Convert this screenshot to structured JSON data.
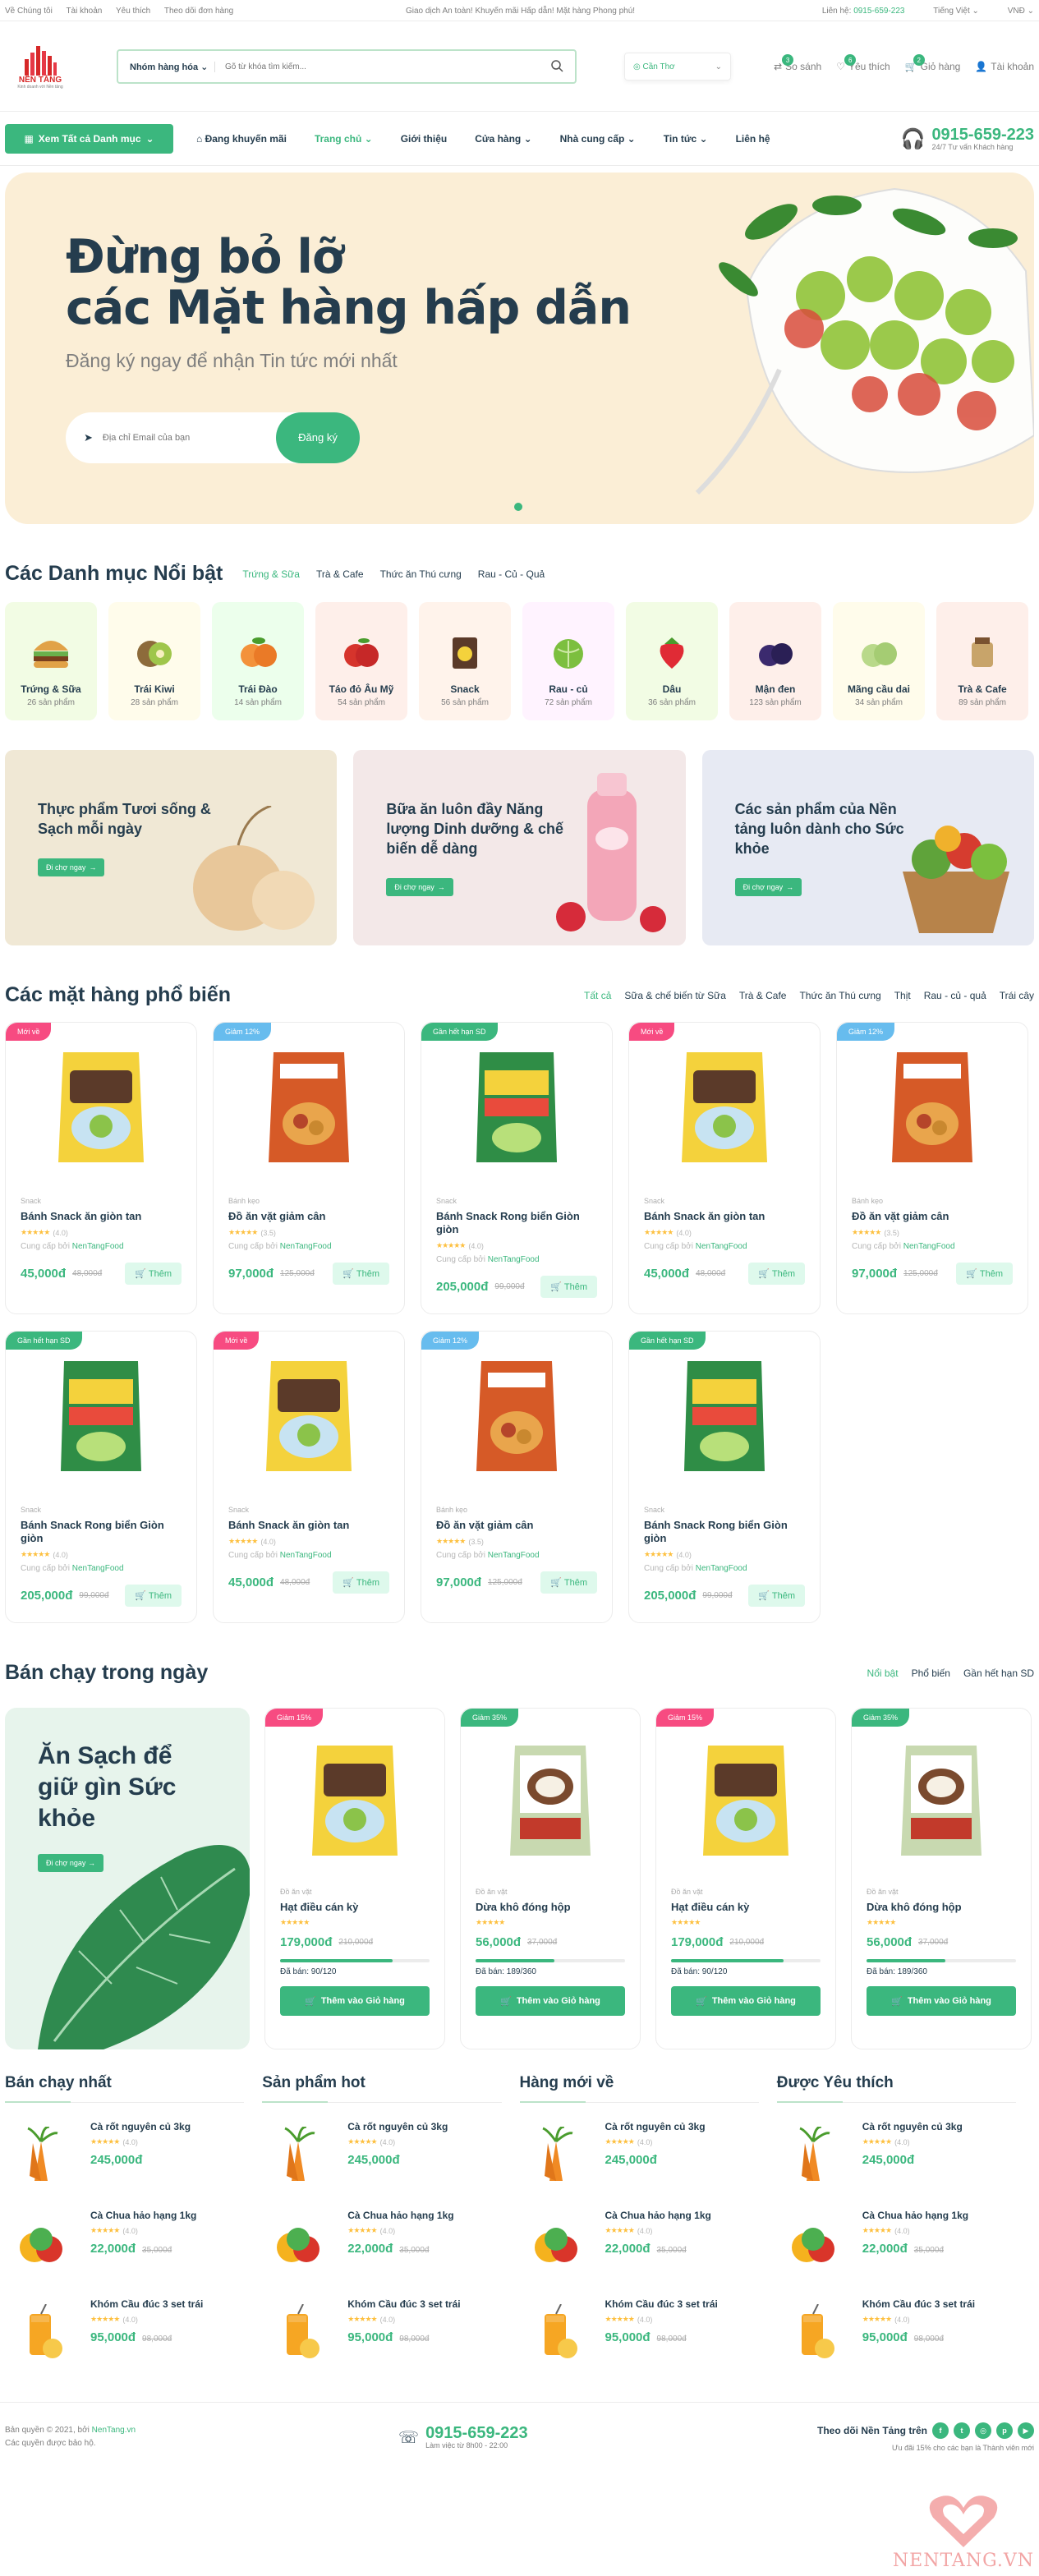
{
  "topbar": {
    "left": [
      "Về Chúng tôi",
      "Tài khoản",
      "Yêu thích",
      "Theo dõi đơn hàng"
    ],
    "center": "Giao dịch An toàn! Khuyến mãi Hấp dẫn! Mặt hàng Phong phú!",
    "hotline_label": "Liên hệ:",
    "hotline": "0915-659-223",
    "lang": "Tiếng Việt",
    "currency": "VNĐ"
  },
  "header": {
    "logo_name": "NỀN TẢNG",
    "logo_tag": "Kinh doanh với Nền tảng",
    "search_category": "Nhóm hàng hóa",
    "search_placeholder": "Gõ từ khóa tìm kiếm...",
    "location": "Cần Thơ",
    "compare": {
      "label": "So sánh",
      "count": "3"
    },
    "wishlist": {
      "label": "Yêu thích",
      "count": "6"
    },
    "cart": {
      "label": "Giỏ hàng",
      "count": "2"
    },
    "account": "Tài khoản"
  },
  "nav": {
    "browse": "Xem Tất cả Danh mục",
    "promo": "Đang khuyến mãi",
    "items": [
      "Trang chủ",
      "Giới thiệu",
      "Cửa hàng",
      "Nhà cung cấp",
      "Tin tức",
      "Liên hệ"
    ],
    "hotline": "0915-659-223",
    "hotline_sub": "24/7 Tư vấn Khách hàng"
  },
  "hero": {
    "title_1": "Đừng bỏ lỡ",
    "title_2": "các Mặt hàng hấp dẫn",
    "subtitle": "Đăng ký ngay để nhận Tin tức mới nhất",
    "email_placeholder": "Địa chỉ Email của bạn",
    "button": "Đăng ký"
  },
  "featured": {
    "title": "Các Danh mục Nổi bật",
    "tabs": [
      "Trứng & Sữa",
      "Trà & Cafe",
      "Thức ăn Thú cưng",
      "Rau - Củ - Quả"
    ],
    "categories": [
      {
        "name": "Trứng & Sữa",
        "count": "26 sản phẩm",
        "bg": "#f2fce4",
        "icon": "burger-icon"
      },
      {
        "name": "Trái Kiwi",
        "count": "28 sản phẩm",
        "bg": "#fffceb",
        "icon": "kiwi-icon"
      },
      {
        "name": "Trái Đào",
        "count": "14 sản phẩm",
        "bg": "#ecffec",
        "icon": "peach-icon"
      },
      {
        "name": "Táo đỏ Âu Mỹ",
        "count": "54 sản phẩm",
        "bg": "#feefea",
        "icon": "apple-icon"
      },
      {
        "name": "Snack",
        "count": "56 sản phẩm",
        "bg": "#fff3eb",
        "icon": "snack-icon"
      },
      {
        "name": "Rau - củ",
        "count": "72 sản phẩm",
        "bg": "#fff3ff",
        "icon": "cabbage-icon"
      },
      {
        "name": "Dâu",
        "count": "36 sản phẩm",
        "bg": "#f2fce4",
        "icon": "strawberry-icon"
      },
      {
        "name": "Mận đen",
        "count": "123 sản phẩm",
        "bg": "#feefea",
        "icon": "plum-icon"
      },
      {
        "name": "Mãng cầu dai",
        "count": "34 sản phẩm",
        "bg": "#fffceb",
        "icon": "custard-apple-icon"
      },
      {
        "name": "Trà & Cafe",
        "count": "89 sản phẩm",
        "bg": "#feefea",
        "icon": "tea-icon"
      }
    ]
  },
  "banners": [
    {
      "text": "Thực phẩm Tươi sống & Sạch mỗi ngày",
      "button": "Đi chợ ngay",
      "bg": "#f0e8d5"
    },
    {
      "text": "Bữa ăn luôn đầy Năng lượng Dinh dưỡng & chế biến dễ dàng",
      "button": "Đi chợ ngay",
      "bg": "#f3e8e8"
    },
    {
      "text": "Các sản phẩm của Nền tảng luôn dành cho Sức khỏe",
      "button": "Đi chợ ngay",
      "bg": "#e7eaf3"
    }
  ],
  "popular": {
    "title": "Các mặt hàng phổ biến",
    "tabs": [
      "Tất cả",
      "Sữa & chế biến từ Sữa",
      "Trà & Cafe",
      "Thức ăn Thú cưng",
      "Thịt",
      "Rau - củ - quả",
      "Trái cây"
    ],
    "vendor_label": "Cung cấp bởi",
    "vendor": "NenTangFood",
    "add_label": "Thêm",
    "products": [
      {
        "tag": "Mới về",
        "tag_color": "#f74b81",
        "type": "Snack",
        "name": "Bánh Snack ăn giòn tan",
        "rating": "(4.0)",
        "stars": "★★★★★",
        "price": "45,000đ",
        "old": "48,000đ",
        "img": "dandy"
      },
      {
        "tag": "Giảm 12%",
        "tag_color": "#67bcee",
        "type": "Bánh kẹo",
        "name": "Đồ ăn vặt giảm cân",
        "rating": "(3.5)",
        "stars": "★★★★★",
        "price": "97,000đ",
        "old": "125,000đ",
        "img": "sahale"
      },
      {
        "tag": "Gần hết hạn SD",
        "tag_color": "#3bb77e",
        "type": "Snack",
        "name": "Bánh Snack Rong biển Giòn giòn",
        "rating": "(4.0)",
        "stars": "★★★★★",
        "price": "205,000đ",
        "old": "99,000đ",
        "img": "veggie"
      },
      {
        "tag": "Mới về",
        "tag_color": "#f74b81",
        "type": "Snack",
        "name": "Bánh Snack ăn giòn tan",
        "rating": "(4.0)",
        "stars": "★★★★★",
        "price": "45,000đ",
        "old": "48,000đ",
        "img": "dandy"
      },
      {
        "tag": "Giảm 12%",
        "tag_color": "#67bcee",
        "type": "Bánh kẹo",
        "name": "Đồ ăn vặt giảm cân",
        "rating": "(3.5)",
        "stars": "★★★★★",
        "price": "97,000đ",
        "old": "125,000đ",
        "img": "sahale"
      },
      {
        "tag": "Gần hết hạn SD",
        "tag_color": "#3bb77e",
        "type": "Snack",
        "name": "Bánh Snack Rong biển Giòn giòn",
        "rating": "(4.0)",
        "stars": "★★★★★",
        "price": "205,000đ",
        "old": "99,000đ",
        "img": "veggie"
      },
      {
        "tag": "Mới về",
        "tag_color": "#f74b81",
        "type": "Snack",
        "name": "Bánh Snack ăn giòn tan",
        "rating": "(4.0)",
        "stars": "★★★★★",
        "price": "45,000đ",
        "old": "48,000đ",
        "img": "dandy"
      },
      {
        "tag": "Giảm 12%",
        "tag_color": "#67bcee",
        "type": "Bánh kẹo",
        "name": "Đồ ăn vặt giảm cân",
        "rating": "(3.5)",
        "stars": "★★★★★",
        "price": "97,000đ",
        "old": "125,000đ",
        "img": "sahale"
      },
      {
        "tag": "Gần hết hạn SD",
        "tag_color": "#3bb77e",
        "type": "Snack",
        "name": "Bánh Snack Rong biển Giòn giòn",
        "rating": "(4.0)",
        "stars": "★★★★★",
        "price": "205,000đ",
        "old": "99,000đ",
        "img": "veggie"
      }
    ]
  },
  "daily": {
    "title": "Bán chạy trong ngày",
    "tabs": [
      "Nổi bật",
      "Phổ biến",
      "Gần hết hạn SD"
    ],
    "banner_text": "Ăn Sạch để giữ gìn Sức khỏe",
    "banner_button": "Đi chợ ngay",
    "cart_label": "Thêm vào Giỏ hàng",
    "products": [
      {
        "tag": "Giảm 15%",
        "tag_color": "#f74b81",
        "type": "Đồ ăn vặt",
        "name": "Hạt điều cán kỳ",
        "price": "179,000đ",
        "old": "210,000đ",
        "sold": "Đã bán: 90/120",
        "progress": 0.75,
        "img": "dandy"
      },
      {
        "tag": "Giảm 35%",
        "tag_color": "#3bb77e",
        "type": "Đồ ăn vặt",
        "name": "Dừa khô đóng hộp",
        "price": "56,000đ",
        "old": "37,000đ",
        "sold": "Đã bán: 189/360",
        "progress": 0.53,
        "img": "coconut"
      },
      {
        "tag": "Giảm 15%",
        "tag_color": "#f74b81",
        "type": "Đồ ăn vặt",
        "name": "Hạt điều cán kỳ",
        "price": "179,000đ",
        "old": "210,000đ",
        "sold": "Đã bán: 90/120",
        "progress": 0.75,
        "img": "dandy"
      },
      {
        "tag": "Giảm 35%",
        "tag_color": "#3bb77e",
        "type": "Đồ ăn vặt",
        "name": "Dừa khô đóng hộp",
        "price": "56,000đ",
        "old": "37,000đ",
        "sold": "Đã bán: 189/360",
        "progress": 0.53,
        "img": "coconut"
      }
    ]
  },
  "lists": [
    {
      "title": "Bán chạy nhất"
    },
    {
      "title": "Sản phẩm hot"
    },
    {
      "title": "Hàng mới về"
    },
    {
      "title": "Được Yêu thích"
    }
  ],
  "list_items": [
    {
      "name": "Cà rốt nguyên củ 3kg",
      "rating": "(4.0)",
      "price": "245,000đ",
      "old": "",
      "img": "carrot"
    },
    {
      "name": "Cà Chua hảo hạng 1kg",
      "rating": "(4.0)",
      "price": "22,000đ",
      "old": "35,000đ",
      "img": "pepper"
    },
    {
      "name": "Khóm Cầu đúc 3 set trái",
      "rating": "(4.0)",
      "price": "95,000đ",
      "old": "98,000đ",
      "img": "juice"
    }
  ],
  "footer": {
    "copy_1": "Bản quyền © 2021, bởi",
    "brand": "NenTang.vn",
    "copy_2": "Các quyền được bảo hộ.",
    "hotline": "0915-659-223",
    "hotline_sub": "Làm việc từ 8h00 - 22:00",
    "follow": "Theo dõi Nền Tảng trên",
    "follow_sub": "Ưu đãi 15% cho các bạn là Thành viên mới",
    "watermark": "NENTANG.VN"
  },
  "colors": {
    "brand": "#3bb77e",
    "pink": "#f74b81",
    "blue": "#67bcee",
    "text": "#253d4e"
  }
}
